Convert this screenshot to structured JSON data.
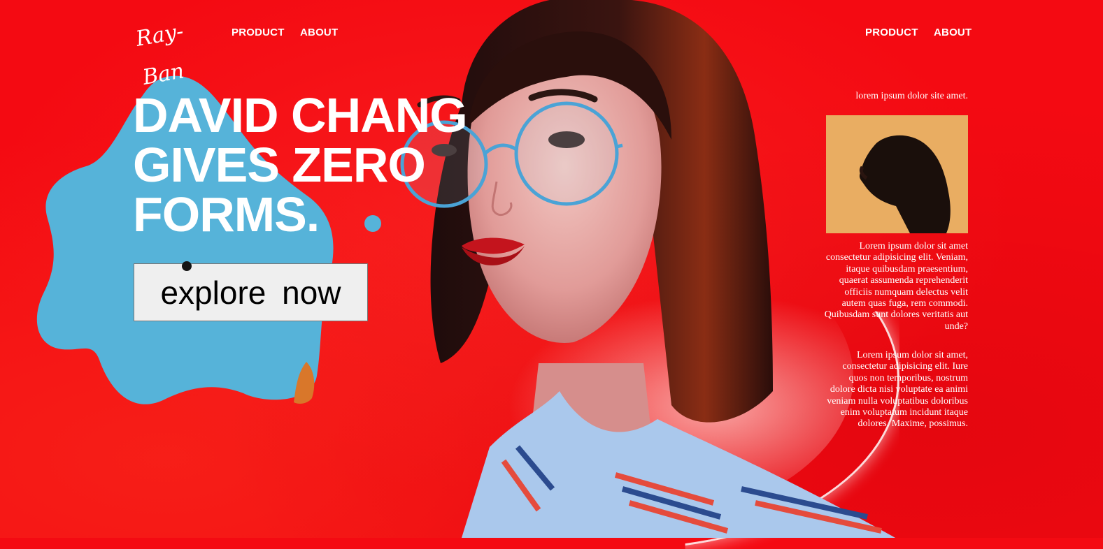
{
  "brand": {
    "logo_text": "Ray-Ban",
    "logo_icon": "rayban-logo"
  },
  "nav_left": [
    {
      "label": "PRODUCT"
    },
    {
      "label": "ABOUT"
    }
  ],
  "nav_right": [
    {
      "label": "PRODUCT"
    },
    {
      "label": "ABOUT"
    }
  ],
  "hero": {
    "line1": "DAVID CHANG",
    "line2": "GIVES ZERO",
    "line3": "FORMS.",
    "cta_label": "explore  now"
  },
  "sidebar": {
    "tagline": "lorem ipsum dolor site amet.",
    "paragraph1": "Lorem ipsum dolor sit amet consectetur adipisicing elit. Veniam, itaque quibusdam praesentium, quaerat assumenda reprehenderit officiis numquam delectus velit autem quas fuga, rem commodi. Quibusdam sunt dolores veritatis aut unde?",
    "paragraph2": "Lorem ipsum dolor sit amet, consectetur adipisicing elit. Iure quos non temporibus, nostrum dolore dicta nisi voluptate ea animi veniam nulla voluptatibus doloribus enim voluptatum incidunt itaque dolores. Maxime, possimus."
  },
  "colors": {
    "background": "#f40a12",
    "blob": "#56b3d9",
    "text": "#ffffff",
    "thumb_bg": "#e9ad62"
  }
}
